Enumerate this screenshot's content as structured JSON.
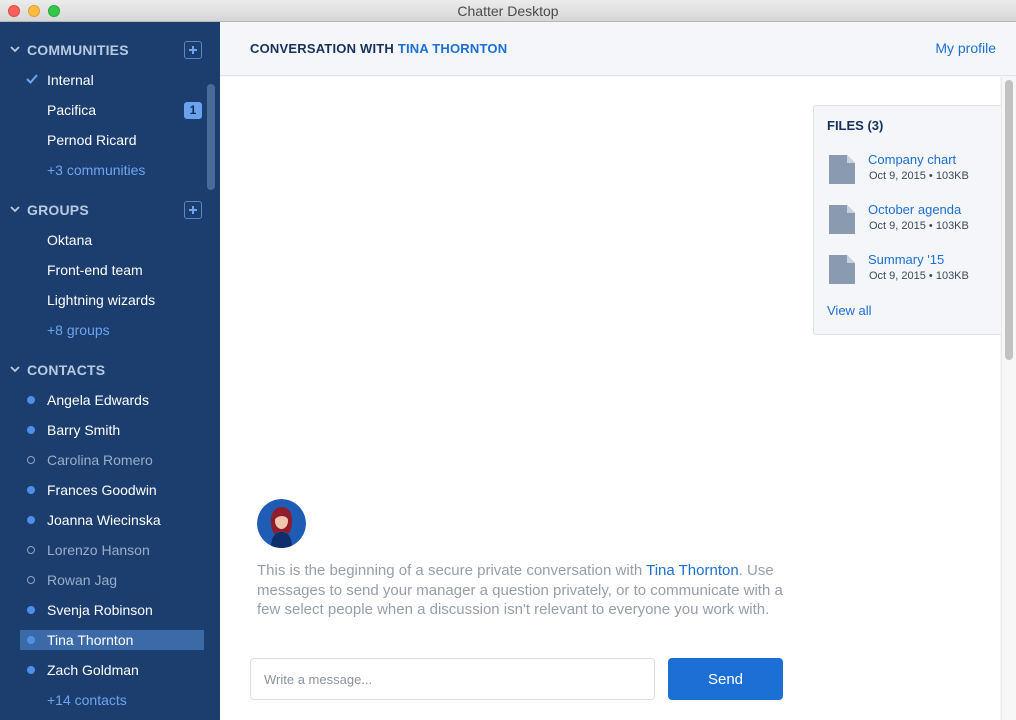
{
  "window": {
    "title": "Chatter Desktop"
  },
  "sidebar": {
    "communities": {
      "title": "COMMUNITIES",
      "items": [
        {
          "label": "Internal",
          "checked": true
        },
        {
          "label": "Pacifica",
          "badge": "1"
        },
        {
          "label": "Pernod Ricard"
        }
      ],
      "more": "+3 communities"
    },
    "groups": {
      "title": "GROUPS",
      "items": [
        {
          "label": "Oktana"
        },
        {
          "label": "Front-end team"
        },
        {
          "label": "Lightning wizards"
        }
      ],
      "more": "+8 groups"
    },
    "contacts": {
      "title": "CONTACTS",
      "items": [
        {
          "label": "Angela Edwards",
          "status": "online"
        },
        {
          "label": "Barry Smith",
          "status": "online"
        },
        {
          "label": "Carolina Romero",
          "status": "offline"
        },
        {
          "label": "Frances Goodwin",
          "status": "online"
        },
        {
          "label": "Joanna Wiecinska",
          "status": "online"
        },
        {
          "label": "Lorenzo Hanson",
          "status": "offline"
        },
        {
          "label": "Rowan Jag",
          "status": "offline"
        },
        {
          "label": "Svenja Robinson",
          "status": "online"
        },
        {
          "label": "Tina Thornton",
          "status": "online",
          "selected": true
        },
        {
          "label": "Zach Goldman",
          "status": "online"
        }
      ],
      "more": "+14 contacts"
    }
  },
  "header": {
    "title_prefix": "CONVERSATION WITH",
    "title_name": "TINA THORNTON",
    "profile_link": "My profile"
  },
  "files": {
    "title": "FILES (3)",
    "items": [
      {
        "name": "Company chart",
        "meta": "Oct 9, 2015 • 103KB"
      },
      {
        "name": "October agenda",
        "meta": "Oct 9, 2015 • 103KB"
      },
      {
        "name": "Summary '15",
        "meta": "Oct 9, 2015 • 103KB"
      }
    ],
    "view_all": "View all"
  },
  "conversation": {
    "intro_before": "This is the beginning of a secure private conversation with ",
    "intro_name": "Tina Thornton",
    "intro_after": ". Use messages to send your manager a question privately, or to communicate with a few select people when a discussion isn't relevant to everyone you work with."
  },
  "composer": {
    "placeholder": "Write a message...",
    "value": "",
    "send_label": "Send"
  },
  "colors": {
    "sidebar_bg": "#1b3e6e",
    "accent": "#1c6fd4",
    "selected_bg": "#3c6aa8",
    "online_dot": "#4f8fe8"
  }
}
